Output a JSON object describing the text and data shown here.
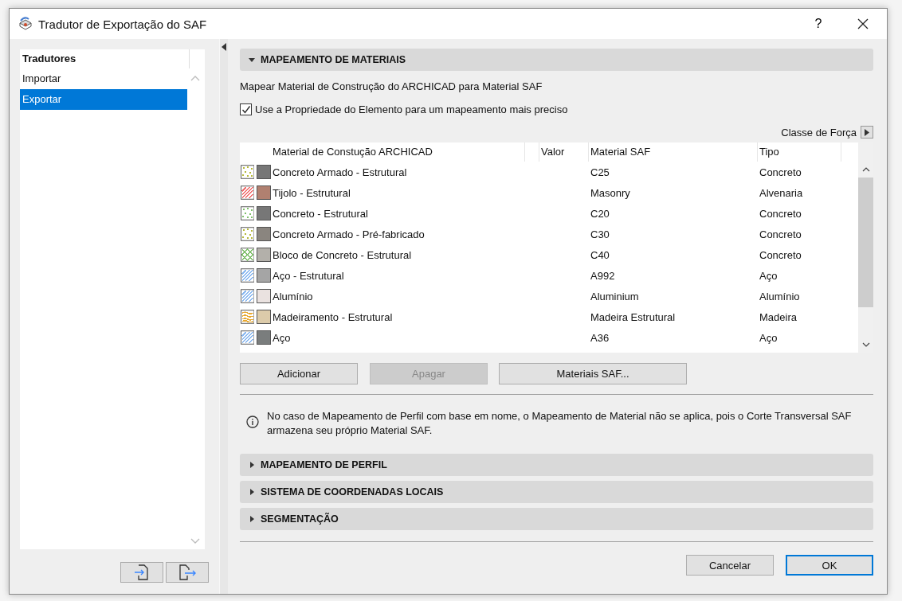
{
  "window": {
    "title": "Tradutor de Exportação do SAF",
    "help": "?"
  },
  "sidebar": {
    "header": "Tradutores",
    "items": [
      {
        "label": "Importar",
        "selected": false
      },
      {
        "label": "Exportar",
        "selected": true
      }
    ]
  },
  "sections": [
    {
      "title": "MAPEAMENTO DE MATERIAIS",
      "expanded": true
    },
    {
      "title": "MAPEAMENTO DE PERFIL",
      "expanded": false
    },
    {
      "title": "SISTEMA DE COORDENADAS LOCAIS",
      "expanded": false
    },
    {
      "title": "SEGMENTAÇÃO",
      "expanded": false
    }
  ],
  "material_mapping": {
    "description": "Mapear Material de Construção do ARCHICAD para Material SAF",
    "use_element_property": {
      "label": "Use a Propriedade do Elemento para um mapeamento mais preciso",
      "checked": true
    },
    "force_class": "Classe de Força",
    "table": {
      "columns": [
        "Material de Constução ARCHICAD",
        "Valor",
        "Material SAF",
        "Tipo"
      ],
      "rows": [
        {
          "swatches": [
            {
              "kind": "dots",
              "color": "#b5b83a"
            },
            {
              "kind": "solid",
              "color": "#777777"
            }
          ],
          "material": "Concreto Armado - Estrutural",
          "saf": "C25",
          "type": "Concreto"
        },
        {
          "swatches": [
            {
              "kind": "hatch",
              "color": "#f07070"
            },
            {
              "kind": "solid",
              "color": "#b08070"
            }
          ],
          "material": "Tijolo - Estrutural",
          "saf": "Masonry",
          "type": "Alvenaria"
        },
        {
          "swatches": [
            {
              "kind": "dots",
              "color": "#7fbf6a"
            },
            {
              "kind": "solid",
              "color": "#777777"
            }
          ],
          "material": "Concreto - Estrutural",
          "saf": "C20",
          "type": "Concreto"
        },
        {
          "swatches": [
            {
              "kind": "dots",
              "color": "#b5b83a"
            },
            {
              "kind": "solid",
              "color": "#8a857f"
            }
          ],
          "material": "Concreto Armado - Pré-fabricado",
          "saf": "C30",
          "type": "Concreto"
        },
        {
          "swatches": [
            {
              "kind": "cross",
              "color": "#7fbf6a"
            },
            {
              "kind": "solid",
              "color": "#b3b0aa"
            }
          ],
          "material": "Bloco de Concreto - Estrutural",
          "saf": "C40",
          "type": "Concreto"
        },
        {
          "swatches": [
            {
              "kind": "hatch",
              "color": "#8ab8f0"
            },
            {
              "kind": "solid",
              "color": "#a5a5a5"
            }
          ],
          "material": "Aço - Estrutural",
          "saf": "A992",
          "type": "Aço"
        },
        {
          "swatches": [
            {
              "kind": "hatch",
              "color": "#8ab8f0"
            },
            {
              "kind": "solid",
              "color": "#eae2e0"
            }
          ],
          "material": "Alumínio",
          "saf": "Aluminium",
          "type": "Alumínio"
        },
        {
          "swatches": [
            {
              "kind": "wave",
              "color": "#e8a830"
            },
            {
              "kind": "solid",
              "color": "#dccbaa"
            }
          ],
          "material": "Madeiramento - Estrutural",
          "saf": "Madeira Estrutural",
          "type": "Madeira"
        },
        {
          "swatches": [
            {
              "kind": "hatch",
              "color": "#8ab8f0"
            },
            {
              "kind": "solid",
              "color": "#7a7d7d"
            }
          ],
          "material": "Aço",
          "saf": "A36",
          "type": "Aço"
        }
      ]
    },
    "buttons": [
      {
        "label": "Adicionar",
        "disabled": false
      },
      {
        "label": "Apagar",
        "disabled": true
      },
      {
        "label": "Materiais SAF...",
        "disabled": false
      }
    ],
    "note": "No caso de Mapeamento de Perfil com base em nome, o Mapeamento de Material não se aplica, pois o Corte Transversal SAF armazena seu próprio Material SAF."
  },
  "footer_buttons": [
    {
      "label": "Cancelar",
      "default": false
    },
    {
      "label": "OK",
      "default": true
    }
  ]
}
